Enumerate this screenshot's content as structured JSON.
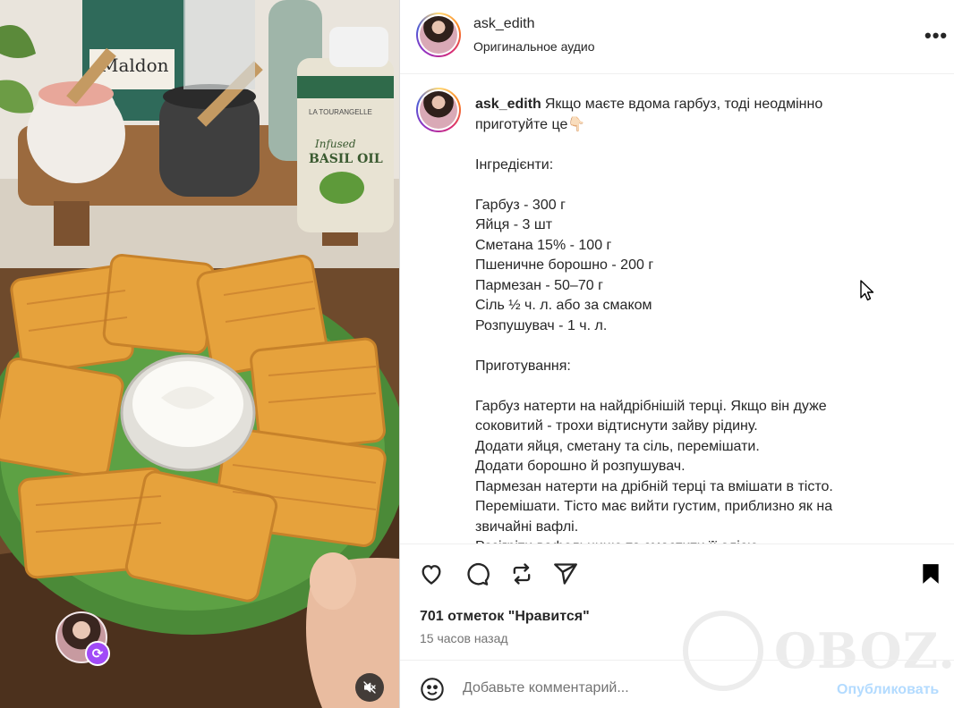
{
  "post": {
    "username": "ask_edith",
    "audio": "Оригинальное аудио",
    "caption": {
      "username": "ask_edith",
      "first_line": "Якщо маєте вдома гарбуз, тоді неодмінно",
      "second_line": "приготуйте це👇🏻",
      "lines": [
        "",
        "Інгредієнти:",
        "",
        "Гарбуз - 300 г",
        "Яйця - 3 шт",
        "Сметана 15% - 100 г",
        "Пшеничне борошно - 200 г",
        "Пармезан - 50–70 г",
        "Сіль ½ ч. л. або за смаком",
        "Розпушувач - 1 ч. л.",
        "",
        "Приготування:",
        "",
        "Гарбуз натерти на найдрібнішій терці. Якщо він дуже",
        "соковитий - трохи відтиснути зайву рідину.",
        "Додати яйця, сметану та сіль, перемішати.",
        "Додати борошно й розпушувач.",
        "Пармезан натерти на дрібній терці та вмішати в тісто.",
        "Перемішати. Тісто має вийти густим, приблизно як на",
        "звичайні вафлі.",
        "Розігріти вафельницю та змастити її олією."
      ]
    },
    "likes": "701 отметок \"Нравится\"",
    "time": "15 часов назад",
    "comment_placeholder": "Добавьте комментарий...",
    "publish_label": "Опубликовать",
    "watermark": "OBOZ.UA",
    "product_label": {
      "brand": "LA TOURANGELLE",
      "name_line1": "Infused",
      "name_line2": "BASIL OIL"
    },
    "jar_label": "Maldon"
  },
  "icons": {
    "like": "heart-icon",
    "comment": "comment-icon",
    "repost": "repost-icon",
    "share": "send-icon",
    "save": "bookmark-icon",
    "more": "more-icon",
    "mute": "muted-speaker-icon",
    "emoji": "emoji-icon"
  },
  "colors": {
    "publish_disabled": "#b3dbff",
    "text": "#262626",
    "muted": "#737373"
  }
}
